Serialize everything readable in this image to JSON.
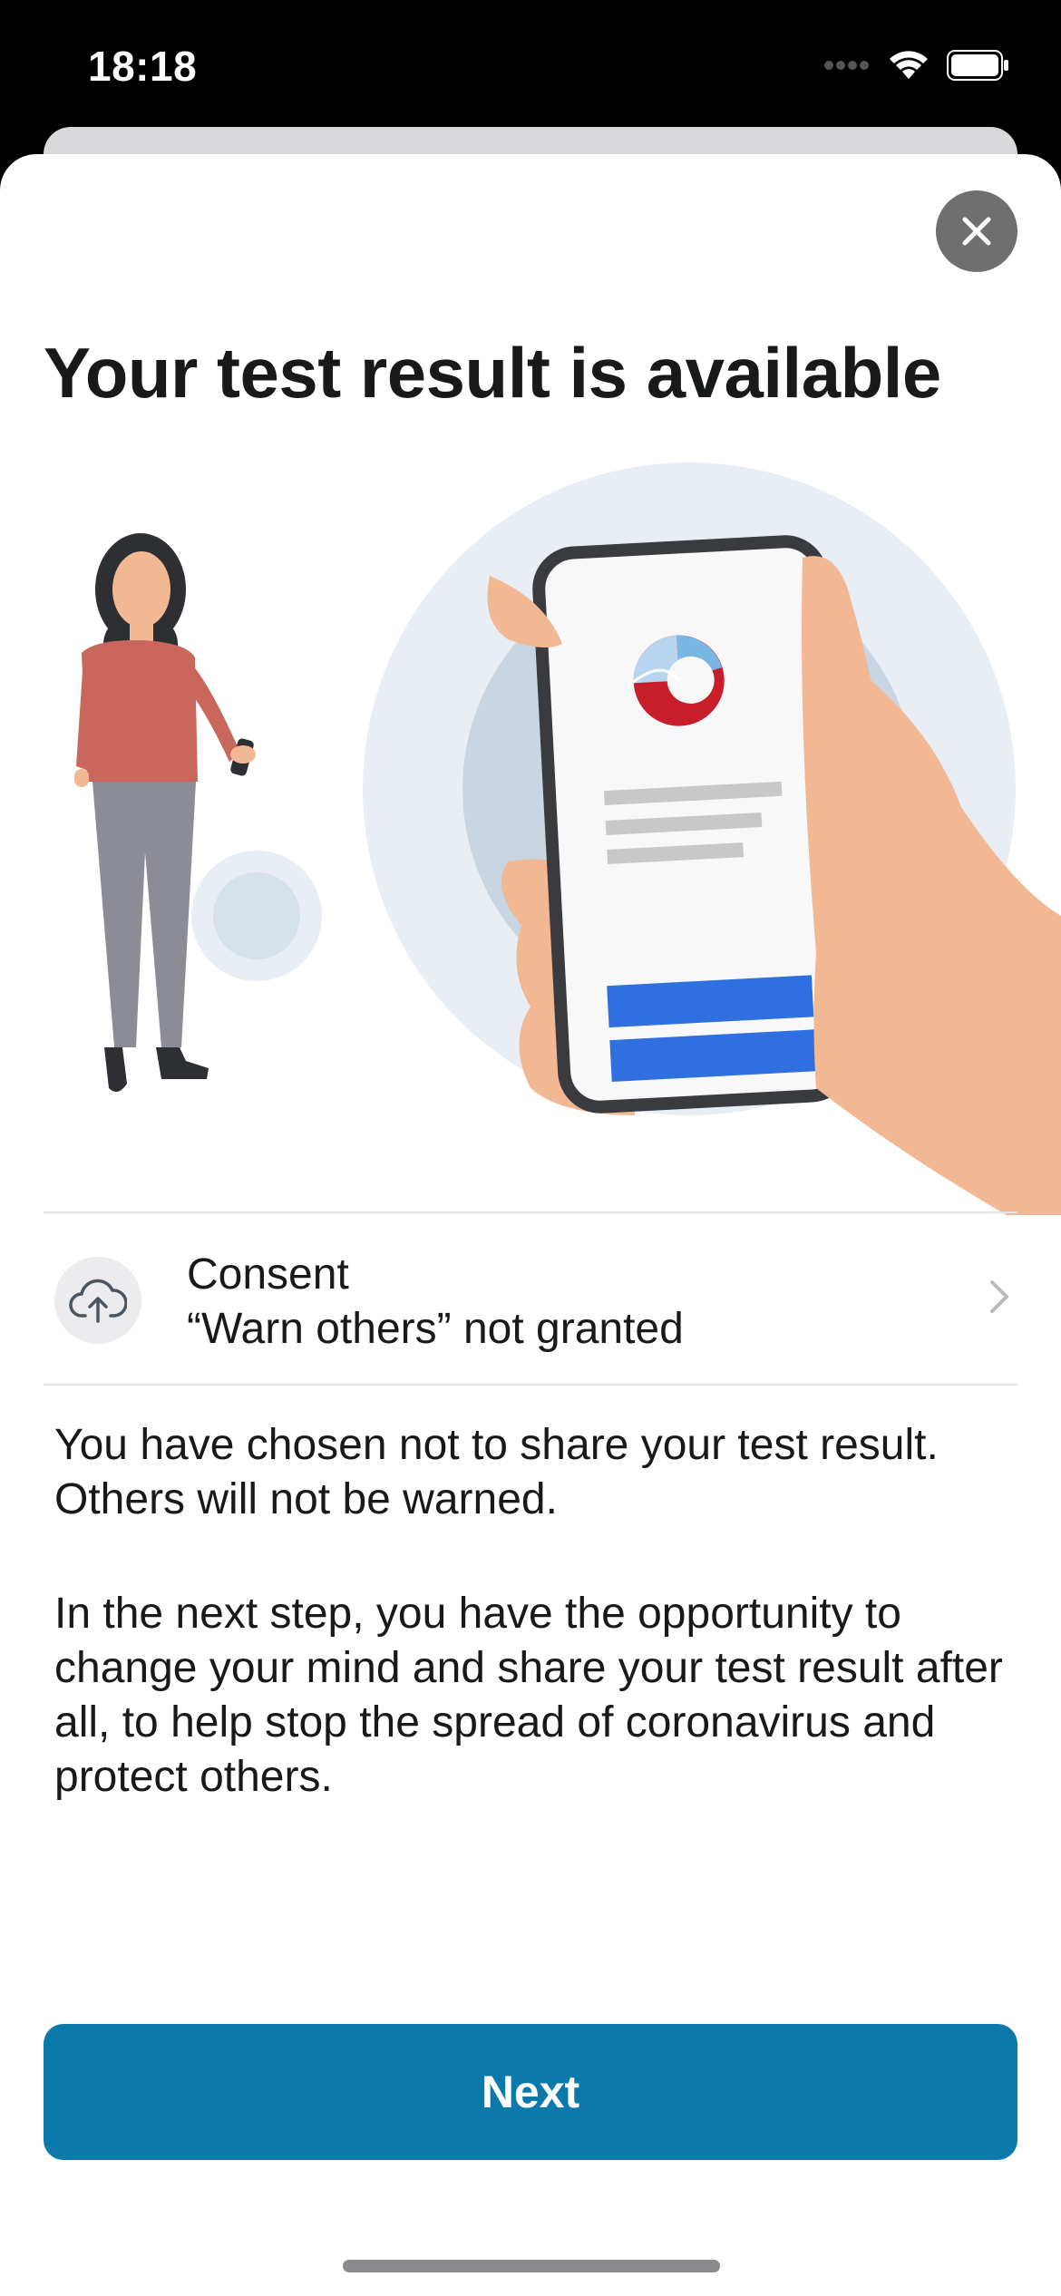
{
  "status_bar": {
    "time": "18:18"
  },
  "sheet": {
    "title": "Your test result is available",
    "consent": {
      "title": "Consent",
      "status": "“Warn others” not granted"
    },
    "paragraph_1": "You have chosen not to share your test result. Others will not be warned.",
    "paragraph_2": "In the next step, you have the opportunity to change your mind and share your test result after all, to help stop the spread of coronavirus and protect others.",
    "next_label": "Next"
  },
  "colors": {
    "accent": "#0b7aab",
    "phone_button": "#2f6fe0",
    "skin": "#f2b894",
    "shirt": "#c9675d"
  }
}
